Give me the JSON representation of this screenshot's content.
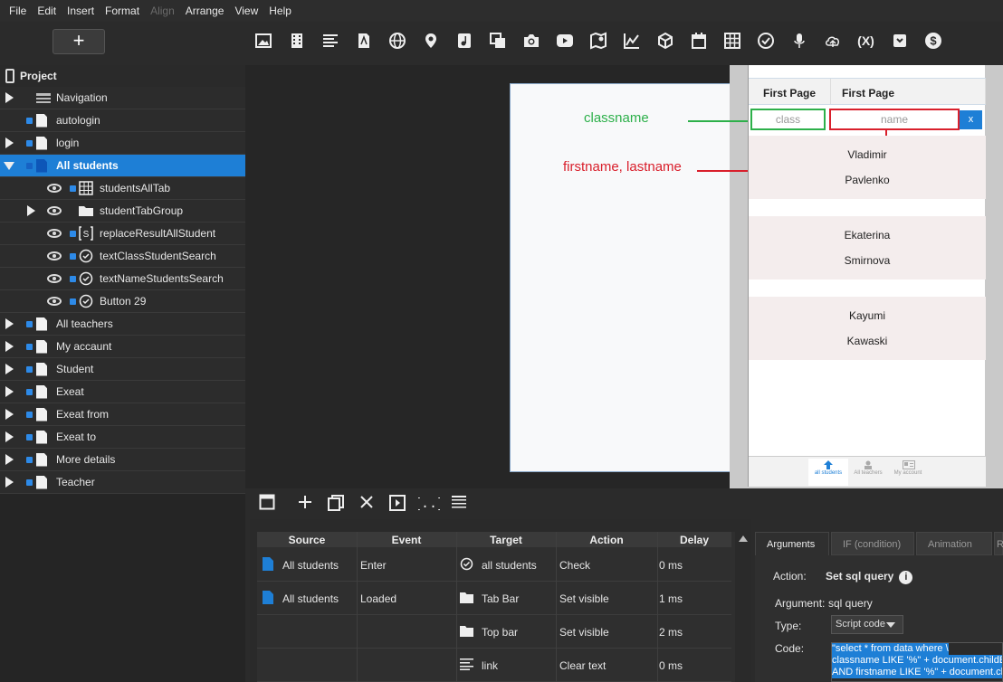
{
  "menu": {
    "items": [
      {
        "label": "File",
        "disabled": false
      },
      {
        "label": "Edit",
        "disabled": false
      },
      {
        "label": "Insert",
        "disabled": false
      },
      {
        "label": "Format",
        "disabled": false
      },
      {
        "label": "Align",
        "disabled": true
      },
      {
        "label": "Arrange",
        "disabled": false
      },
      {
        "label": "View",
        "disabled": false
      },
      {
        "label": "Help",
        "disabled": false
      }
    ]
  },
  "toolbar": {
    "add_label": "+",
    "variable_icon_text": "(X)"
  },
  "tree": {
    "root_label": "Project",
    "items": [
      {
        "label": "Navigation"
      },
      {
        "label": "autologin"
      },
      {
        "label": "login"
      },
      {
        "label": "All students"
      },
      {
        "label": "studentsAllTab"
      },
      {
        "label": "studentTabGroup"
      },
      {
        "label": "replaceResultAllStudent"
      },
      {
        "label": "textClassStudentSearch"
      },
      {
        "label": "textNameStudentsSearch"
      },
      {
        "label": "Button 29"
      },
      {
        "label": "All teachers"
      },
      {
        "label": "My accaunt"
      },
      {
        "label": "Student"
      },
      {
        "label": "Exeat"
      },
      {
        "label": "Exeat from"
      },
      {
        "label": "Exeat to"
      },
      {
        "label": "More details"
      },
      {
        "label": "Teacher"
      }
    ]
  },
  "canvas": {
    "annotation_green": "classname",
    "annotation_red": "firstname, lastname"
  },
  "preview": {
    "tab1": "First Page",
    "tab2": "First Page",
    "class_placeholder": "class",
    "name_placeholder": "name",
    "clear_label": "x",
    "students": [
      {
        "first": "Vladimir",
        "last": "Pavlenko"
      },
      {
        "first": "Ekaterina",
        "last": "Smirnova"
      },
      {
        "first": "Kayumi",
        "last": "Kawaski"
      }
    ],
    "bottom_tabs": [
      "all students",
      "All teachers",
      "My account"
    ]
  },
  "actions": {
    "headers": [
      "Source",
      "Event",
      "Target",
      "Action",
      "Delay"
    ],
    "rows": [
      {
        "source": "All students",
        "event": "Enter",
        "target": "all students",
        "action": "Check",
        "delay": "0 ms"
      },
      {
        "source": "All students",
        "event": "Loaded",
        "target": "Tab Bar",
        "action": "Set visible",
        "delay": "1 ms"
      },
      {
        "source": "",
        "event": "",
        "target": "Top bar",
        "action": "Set visible",
        "delay": "2 ms"
      },
      {
        "source": "",
        "event": "",
        "target": "link",
        "action": "Clear text",
        "delay": "0 ms"
      }
    ]
  },
  "arguments": {
    "tabs": [
      "Arguments",
      "IF (condition)",
      "Animation",
      "R"
    ],
    "action_key": "Action:",
    "action_value": "Set sql query",
    "info_glyph": "i",
    "argument_key": "Argument:",
    "argument_value": "sql query",
    "type_key": "Type:",
    "type_value": "Script code",
    "code_key": "Code:",
    "code_lines": [
      "\"select * from data where \\",
      "classname LIKE '%\" + document.childBy",
      "AND firstname LIKE '%\" + document.ch"
    ]
  }
}
